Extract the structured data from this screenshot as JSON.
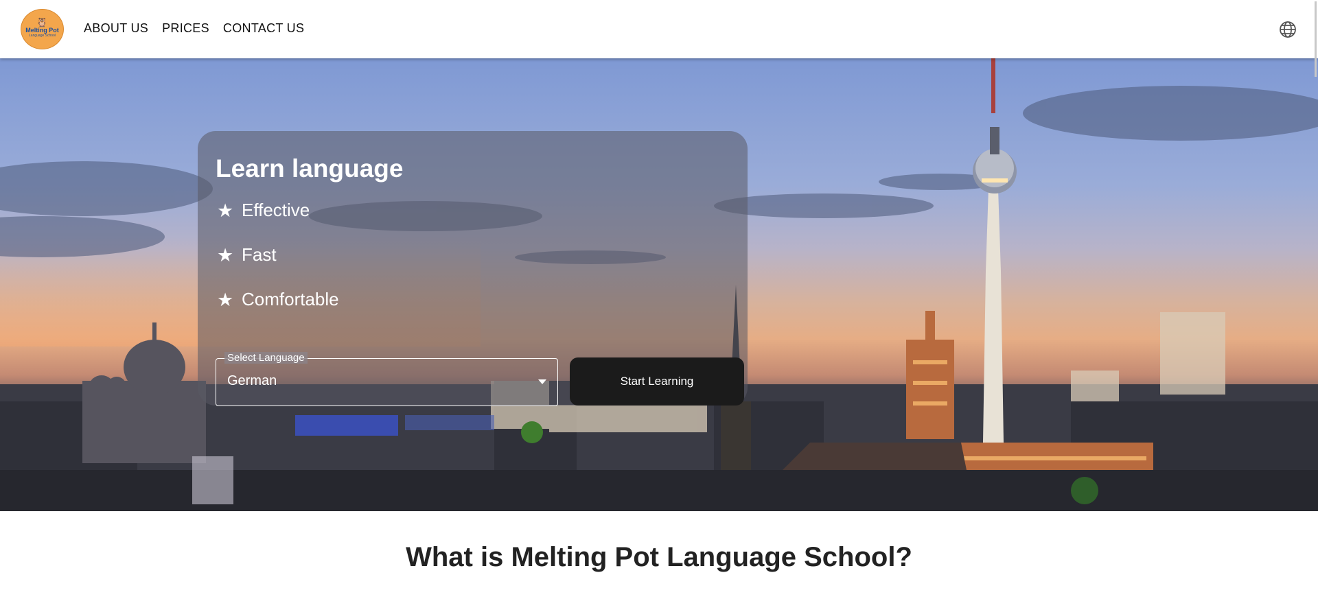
{
  "header": {
    "logo": {
      "brand": "Melting Pot",
      "sub": "Language School"
    },
    "nav": [
      {
        "label": "ABOUT US"
      },
      {
        "label": "PRICES"
      },
      {
        "label": "CONTACT US"
      }
    ],
    "language_icon": "globe-icon"
  },
  "hero": {
    "title": "Learn language",
    "features": [
      {
        "icon": "star-icon",
        "label": "Effective"
      },
      {
        "icon": "star-icon",
        "label": "Fast"
      },
      {
        "icon": "star-icon",
        "label": "Comfortable"
      }
    ],
    "language_select": {
      "legend": "Select Language",
      "value": "German"
    },
    "cta_label": "Start Learning"
  },
  "section": {
    "title": "What is Melting Pot Language School?"
  },
  "colors": {
    "logo_bg": "#f3a64c",
    "logo_text": "#1d4f9c",
    "button_bg": "#1b1b1b"
  }
}
